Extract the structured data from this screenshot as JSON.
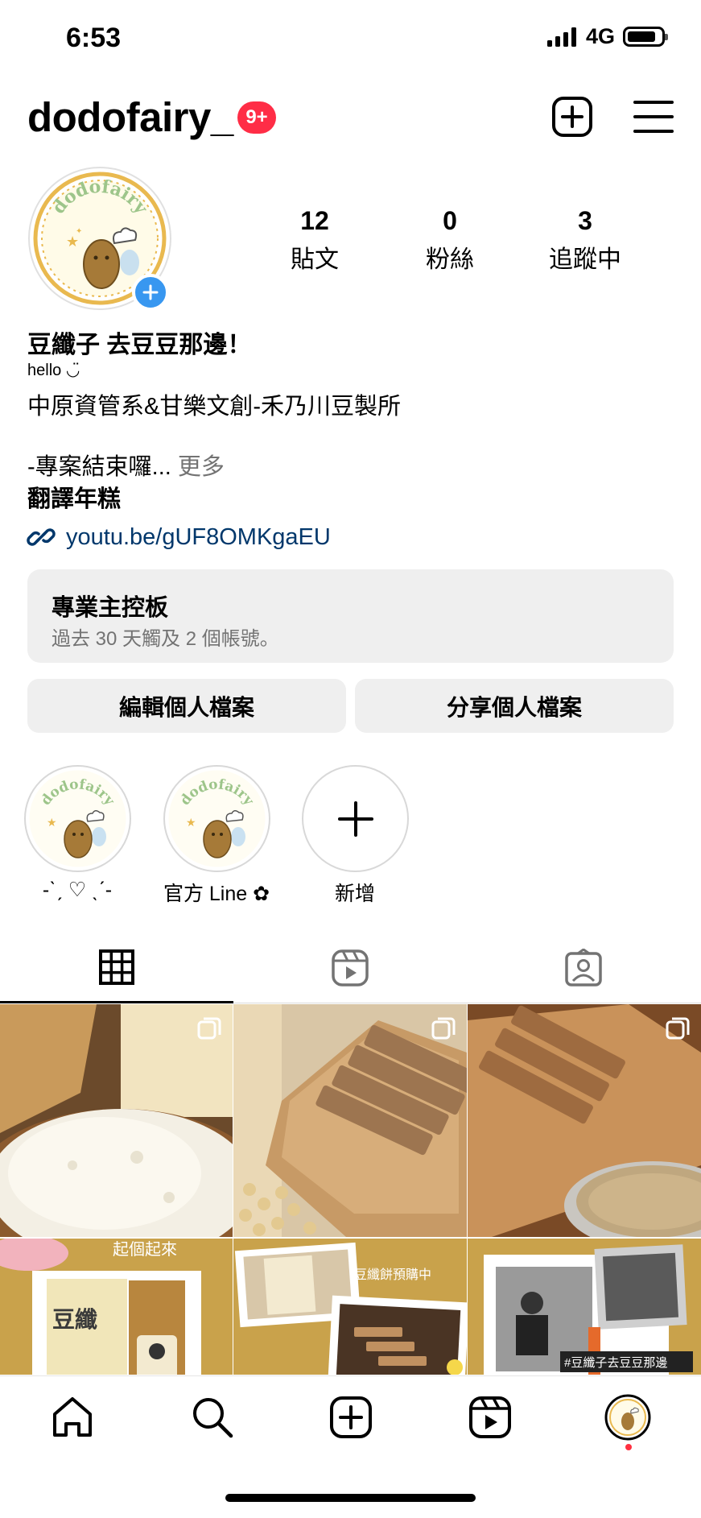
{
  "status_bar": {
    "time": "6:53",
    "network": "4G"
  },
  "header": {
    "username": "dodofairy_",
    "notification_badge": "9+"
  },
  "profile": {
    "avatar_text": "dodofairy",
    "stats": [
      {
        "count": "12",
        "label": "貼文"
      },
      {
        "count": "0",
        "label": "粉絲"
      },
      {
        "count": "3",
        "label": "追蹤中"
      }
    ],
    "display_name": "豆纖子 去豆豆那邊！",
    "pronoun_line": "hello ◡̈",
    "bio_line1": "中原資管系&甘樂文創-禾乃川豆製所",
    "bio_line2": "-專案結束囉...",
    "more_label": "更多",
    "bio_line3": "翻譯年糕",
    "link": "youtu.be/gUF8OMKgaEU"
  },
  "dashboard": {
    "title": "專業主控板",
    "subtitle": "過去 30 天觸及 2 個帳號。"
  },
  "actions": {
    "edit": "編輯個人檔案",
    "share": "分享個人檔案"
  },
  "highlights": [
    {
      "label": "-ˋˏ ♡ ˎˊ-"
    },
    {
      "label": "官方 Line ✿"
    },
    {
      "label": "新增"
    }
  ],
  "grid_posts": {
    "post4_caption": "起個起來",
    "post5_caption": "豆纖餅預購中",
    "post6_caption": "#豆纖子去豆豆那邊",
    "post4_package": "豆纖"
  },
  "colors": {
    "badge": "#ff2d46",
    "link": "#00376b",
    "button_bg": "#efefef",
    "avatar_ring": "#e9b94f",
    "avatar_plus": "#3897f0",
    "dot": "#ff3040"
  }
}
